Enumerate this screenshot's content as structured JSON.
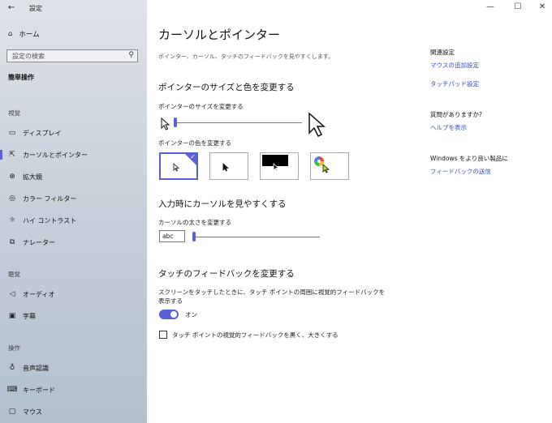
{
  "titlebar": {
    "back_icon": "←",
    "app_title": "設定",
    "minimize": "—",
    "maximize": "☐",
    "close": "✕"
  },
  "sidebar": {
    "home_label": "ホーム",
    "search_placeholder": "設定の検索",
    "section_title": "簡単操作",
    "groups": [
      {
        "label": "視覚",
        "items": [
          {
            "icon": "display-icon",
            "label": "ディスプレイ"
          },
          {
            "icon": "pointer-icon",
            "label": "カーソルとポインター",
            "active": true
          },
          {
            "icon": "magnifier-icon",
            "label": "拡大鏡"
          },
          {
            "icon": "color-filter-icon",
            "label": "カラー フィルター"
          },
          {
            "icon": "contrast-icon",
            "label": "ハイ コントラスト"
          },
          {
            "icon": "narrator-icon",
            "label": "ナレーター"
          }
        ]
      },
      {
        "label": "聴覚",
        "items": [
          {
            "icon": "audio-icon",
            "label": "オーディオ"
          },
          {
            "icon": "caption-icon",
            "label": "字幕"
          }
        ]
      },
      {
        "label": "操作",
        "items": [
          {
            "icon": "mic-icon",
            "label": "音声認識"
          },
          {
            "icon": "keyboard-icon",
            "label": "キーボード"
          },
          {
            "icon": "mouse-icon",
            "label": "マウス"
          }
        ]
      }
    ]
  },
  "main": {
    "title": "カーソルとポインター",
    "description": "ポインター、カーソル、タッチのフィードバックを見やすくします。",
    "pointer_section": {
      "heading": "ポインターのサイズと色を変更する",
      "size_label": "ポインターのサイズを変更する",
      "size_value": 0.0,
      "color_label": "ポインターの色を変更する",
      "color_options": [
        {
          "name": "white",
          "selected": true
        },
        {
          "name": "black",
          "selected": false
        },
        {
          "name": "inverted",
          "selected": false
        },
        {
          "name": "custom",
          "selected": false
        }
      ]
    },
    "cursor_section": {
      "heading": "入力時にカーソルを見やすくする",
      "thickness_label": "カーソルの太さを変更する",
      "preview_text": "abc",
      "thickness_value": 0.0
    },
    "touch_section": {
      "heading": "タッチのフィードバックを変更する",
      "visual_feedback_label_1": "スクリーンをタッチしたときに、タッチ ポイントの周囲に視覚的フィードバックを",
      "visual_feedback_label_2": "表示する",
      "toggle_state": "オン",
      "darker_label": "タッチ ポイントの視覚的フィードバックを黒く、大きくする"
    }
  },
  "right_panel": {
    "related_heading": "関連設定",
    "related_links": [
      "マウスの追加設定",
      "タッチパッド設定"
    ],
    "question_heading": "質問がありますか?",
    "help_link": "ヘルプを表示",
    "feedback_heading": "Windows をより良い製品に",
    "feedback_link": "フィードバックの送信"
  },
  "colors": {
    "accent": "#5a5fd6",
    "link": "#3a4fbf"
  }
}
